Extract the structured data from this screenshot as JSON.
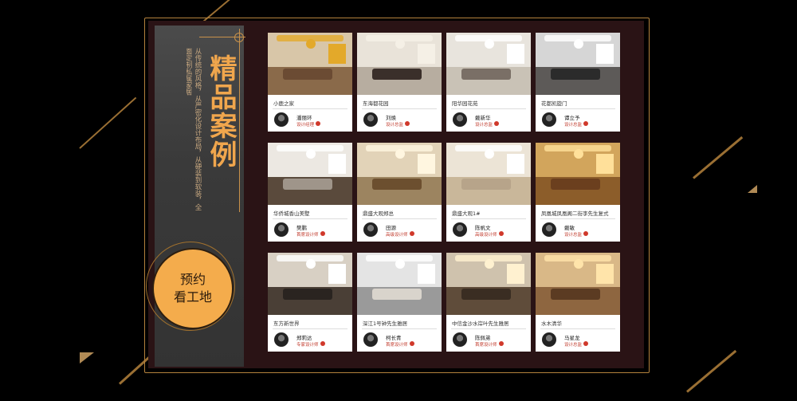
{
  "sidebar": {
    "title": "精品案例",
    "description": "从传统的风格，从严密化设计布局，从硬装到软装，全面定制私属家居",
    "badge_line1": "预约",
    "badge_line2": "看工地"
  },
  "cases": [
    {
      "name": "小鹿之家",
      "designer": "潘丽环",
      "role": "设计经理"
    },
    {
      "name": "东海都花园",
      "designer": "刘焕",
      "role": "设计总监"
    },
    {
      "name": "阳华园花苑",
      "designer": "戴新华",
      "role": "设计总监"
    },
    {
      "name": "花都凯旋门",
      "designer": "谭立予",
      "role": "设计总监"
    },
    {
      "name": "华侨城香山美墅",
      "designer": "樊鹏",
      "role": "首席设计师"
    },
    {
      "name": "鼎盛大观郑总",
      "designer": "田源",
      "role": "高级设计师"
    },
    {
      "name": "鼎盛大观1#",
      "designer": "陈帆文",
      "role": "高级设计师"
    },
    {
      "name": "凤凰城凤凰阁二街李先生复式",
      "designer": "戴敏",
      "role": "设计总监"
    },
    {
      "name": "东方新世界",
      "designer": "郑莉达",
      "role": "专家设计师"
    },
    {
      "name": "深江1号钟先生雅居",
      "designer": "柯长青",
      "role": "首席设计师"
    },
    {
      "name": "中信金沙水岸叶先生雅居",
      "designer": "陈佩弟",
      "role": "首席设计师"
    },
    {
      "name": "水木清华",
      "designer": "马星龙",
      "role": "设计总监"
    }
  ],
  "photo_palettes": [
    {
      "wall": "#d8c6a8",
      "floor": "#8a6a4a",
      "accent": "#e3a92a",
      "sofa": "#6b4b33"
    },
    {
      "wall": "#e9e3d9",
      "floor": "#b7ada0",
      "accent": "#f5f0e6",
      "sofa": "#3a2f2a"
    },
    {
      "wall": "#e8e4dd",
      "floor": "#c9c2b6",
      "accent": "#ffffff",
      "sofa": "#7a6f66"
    },
    {
      "wall": "#d6d6d6",
      "floor": "#5d5a58",
      "accent": "#ffffff",
      "sofa": "#2b2b2b"
    },
    {
      "wall": "#ece8e2",
      "floor": "#5a4a3c",
      "accent": "#ffffff",
      "sofa": "#9f958a"
    },
    {
      "wall": "#e2d3b8",
      "floor": "#9c8460",
      "accent": "#fff6e0",
      "sofa": "#6c4f2f"
    },
    {
      "wall": "#ece4d6",
      "floor": "#c9b79a",
      "accent": "#ffffff",
      "sofa": "#b7a48a"
    },
    {
      "wall": "#d2a55c",
      "floor": "#8c5d2a",
      "accent": "#ffe09a",
      "sofa": "#6b3f1e"
    },
    {
      "wall": "#d8d0c4",
      "floor": "#4a3f36",
      "accent": "#ffffff",
      "sofa": "#2a2420"
    },
    {
      "wall": "#e4e4e4",
      "floor": "#9a9a9a",
      "accent": "#ffffff",
      "sofa": "#d9d4cc"
    },
    {
      "wall": "#cfc2ad",
      "floor": "#5f4c3a",
      "accent": "#fff1d0",
      "sofa": "#3a2d22"
    },
    {
      "wall": "#d9b887",
      "floor": "#8e6640",
      "accent": "#ffe4aa",
      "sofa": "#5b3b22"
    }
  ],
  "colors": {
    "accent": "#f0a64d",
    "frame": "#b4823d",
    "panel": "#2a1315",
    "role_text": "#c0392b"
  }
}
